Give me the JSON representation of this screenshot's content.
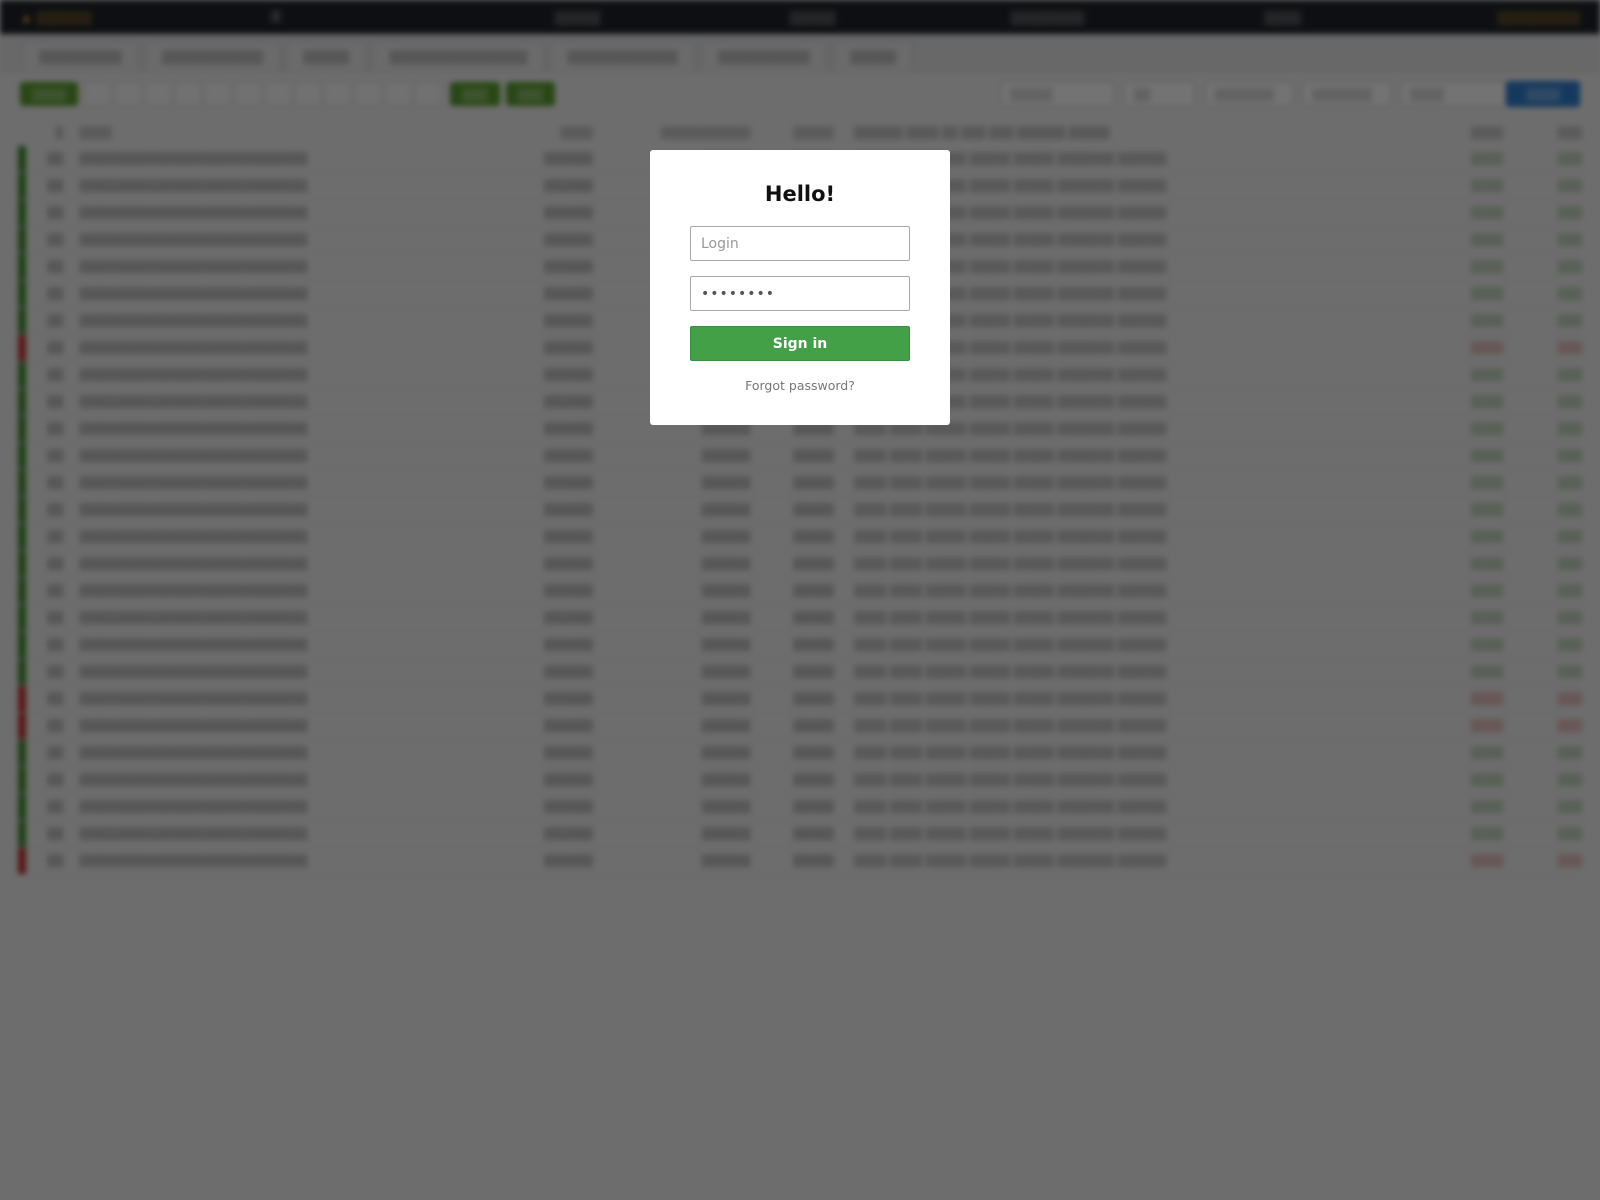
{
  "login_modal": {
    "title": "Hello!",
    "login_placeholder": "Login",
    "password_value": "password",
    "signin_label": "Sign in",
    "forgot_label": "Forgot password?"
  },
  "colors": {
    "signin_button": "#43a047",
    "overlay": "#000000",
    "row_positive": "#3d8d2a",
    "row_negative": "#c0322b"
  },
  "background": {
    "rows_positive": [
      true,
      true,
      true,
      true,
      true,
      true,
      true,
      false,
      true,
      true,
      true,
      true,
      true,
      true,
      true,
      true,
      true,
      true,
      true,
      true,
      false,
      false,
      true,
      true,
      true,
      true,
      false
    ]
  }
}
